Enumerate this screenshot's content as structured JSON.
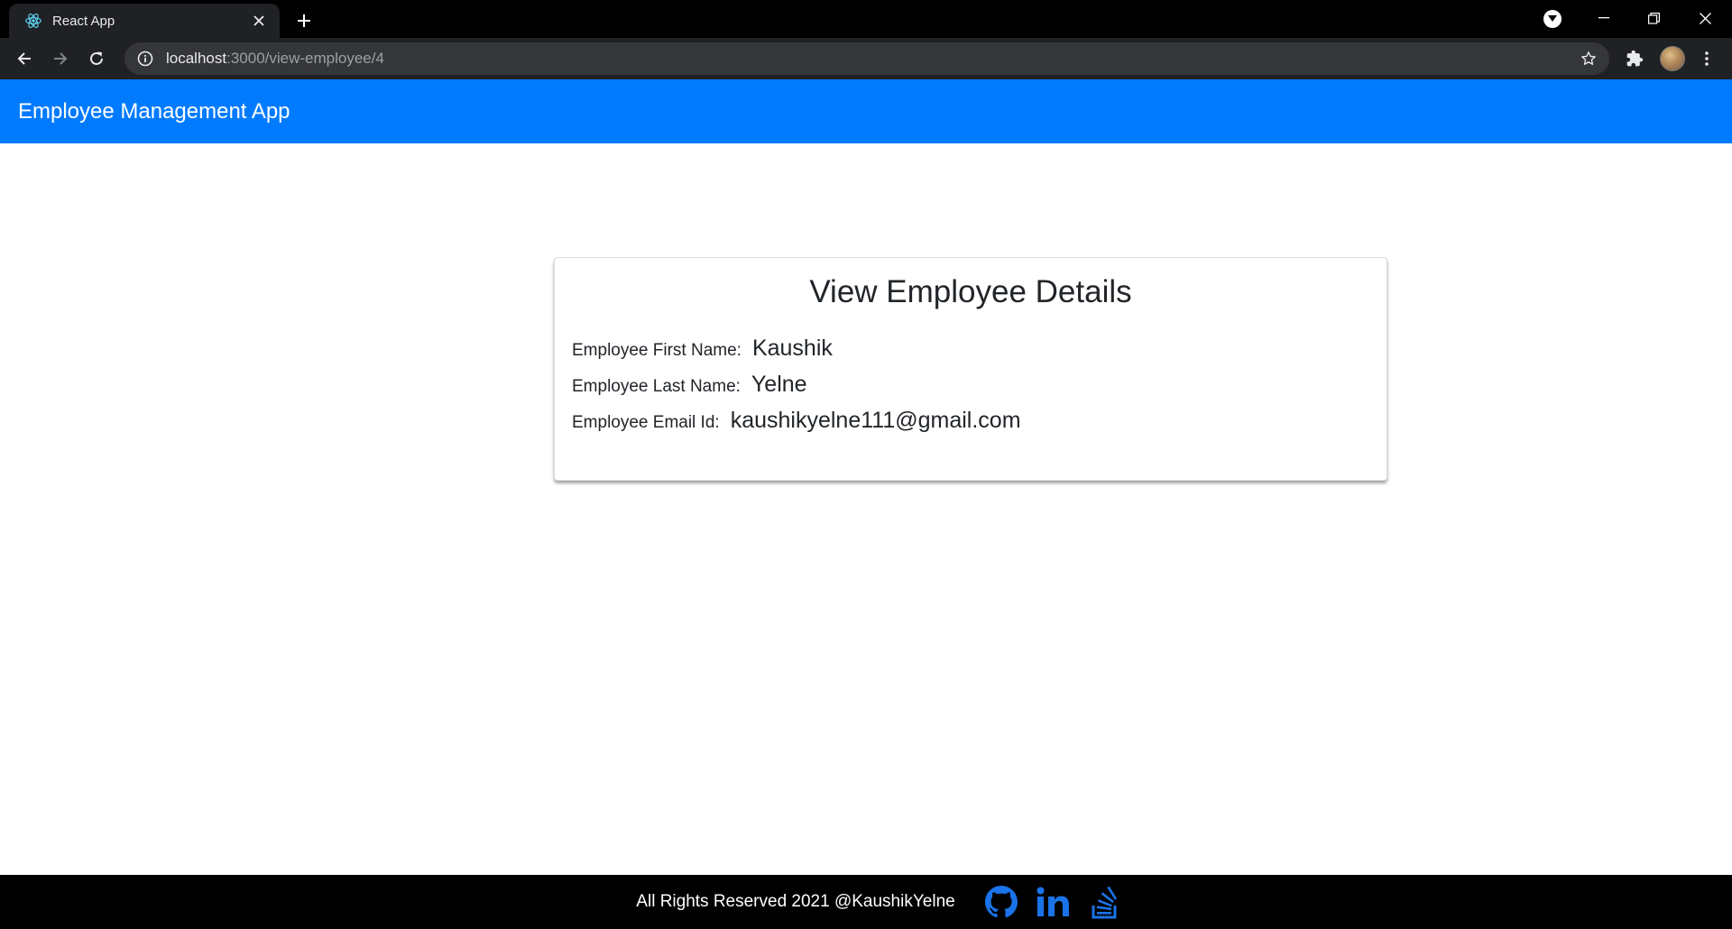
{
  "browser": {
    "tab_title": "React App",
    "url_host": "localhost",
    "url_path": ":3000/view-employee/4"
  },
  "header": {
    "brand": "Employee Management App",
    "color": "#007bff"
  },
  "card": {
    "title": "View Employee Details",
    "fields": [
      {
        "label": "Employee First Name:",
        "value": "Kaushik"
      },
      {
        "label": "Employee Last Name:",
        "value": "Yelne"
      },
      {
        "label": "Employee Email Id:",
        "value": "kaushikyelne111@gmail.com"
      }
    ]
  },
  "footer": {
    "text": "All Rights Reserved 2021 @KaushikYelne",
    "links": [
      {
        "icon": "github-icon"
      },
      {
        "icon": "linkedin-icon"
      },
      {
        "icon": "stackoverflow-icon"
      }
    ],
    "icon_color": "#1a73e8"
  }
}
